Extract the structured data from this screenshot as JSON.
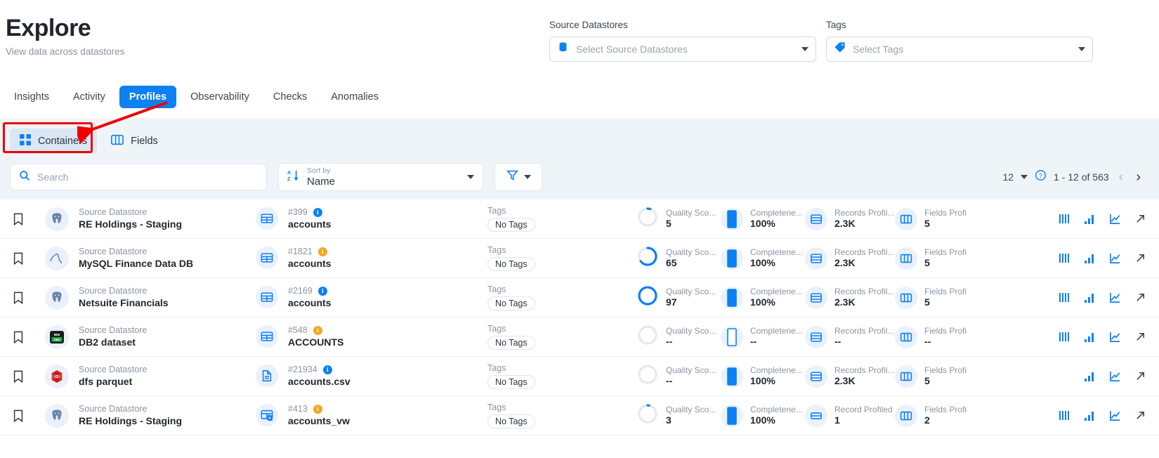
{
  "header": {
    "title": "Explore",
    "subtitle": "View data across datastores"
  },
  "filters": [
    {
      "label": "Source Datastores",
      "placeholder": "Select Source Datastores",
      "icon": "database-icon"
    },
    {
      "label": "Tags",
      "placeholder": "Select Tags",
      "icon": "tag-icon"
    }
  ],
  "tabs": [
    {
      "label": "Insights",
      "active": false
    },
    {
      "label": "Activity",
      "active": false
    },
    {
      "label": "Profiles",
      "active": true
    },
    {
      "label": "Observability",
      "active": false
    },
    {
      "label": "Checks",
      "active": false
    },
    {
      "label": "Anomalies",
      "active": false
    }
  ],
  "subnav": [
    {
      "label": "Containers",
      "icon": "grid-icon",
      "active": true,
      "highlighted": true
    },
    {
      "label": "Fields",
      "icon": "columns-icon",
      "active": false,
      "highlighted": false
    }
  ],
  "toolbar": {
    "search_placeholder": "Search",
    "search_icon": "search-icon",
    "sort_label": "Sort by",
    "sort_value": "Name",
    "sort_icon": "sort-az-icon",
    "filter_icon": "funnel-icon",
    "page_size": "12",
    "help_icon": "help-circle-icon",
    "range": "1 - 12 of 563",
    "prev_icon": "chevron-left-icon",
    "next_icon": "chevron-right-icon"
  },
  "colors": {
    "accent": "#0d80f2",
    "highlight": "#ef0000",
    "amber": "#f5a623",
    "panel": "#eff4f9"
  },
  "table": {
    "labels": {
      "datastore": "Source Datastore",
      "tags": "Tags",
      "quality": "Quality Sco...",
      "completeness": "Completene...",
      "records": "Records Profil...",
      "records_singular": "Record Profiled",
      "fields": "Fields Profi"
    },
    "rows": [
      {
        "bookmark_icon": "bookmark-icon",
        "datastore_icon": "postgresql-icon",
        "datastore_name": "RE Holdings - Staging",
        "container_icon": "table-icon",
        "container_id": "#399",
        "badge": "blue",
        "container_name": "accounts",
        "tags_label": "Tags",
        "tag": "No Tags",
        "quality_label": "Quality Sco...",
        "quality_value": "5",
        "quality_pct": 5,
        "completeness_label": "Completene...",
        "completeness_value": "100%",
        "completeness_pct": 100,
        "records_label": "Records Profil...",
        "records_value": "2.3K",
        "fields_label": "Fields Profi",
        "fields_value": "5",
        "actions": [
          "bars-icon",
          "bar-chart-icon",
          "line-chart-icon",
          "external-link-icon"
        ]
      },
      {
        "bookmark_icon": "bookmark-icon",
        "datastore_icon": "mysql-icon",
        "datastore_name": "MySQL Finance Data DB",
        "container_icon": "table-icon",
        "container_id": "#1821",
        "badge": "amber",
        "container_name": "accounts",
        "tags_label": "Tags",
        "tag": "No Tags",
        "quality_label": "Quality Sco...",
        "quality_value": "65",
        "quality_pct": 65,
        "completeness_label": "Completene...",
        "completeness_value": "100%",
        "completeness_pct": 100,
        "records_label": "Records Profil...",
        "records_value": "2.3K",
        "fields_label": "Fields Profi",
        "fields_value": "5",
        "actions": [
          "bars-icon",
          "bar-chart-icon",
          "line-chart-icon",
          "external-link-icon"
        ]
      },
      {
        "bookmark_icon": "bookmark-icon",
        "datastore_icon": "postgresql-icon",
        "datastore_name": "Netsuite Financials",
        "container_icon": "table-icon",
        "container_id": "#2169",
        "badge": "blue",
        "container_name": "accounts",
        "tags_label": "Tags",
        "tag": "No Tags",
        "quality_label": "Quality Sco...",
        "quality_value": "97",
        "quality_pct": 97,
        "completeness_label": "Completene...",
        "completeness_value": "100%",
        "completeness_pct": 100,
        "records_label": "Records Profil...",
        "records_value": "2.3K",
        "fields_label": "Fields Profi",
        "fields_value": "5",
        "actions": [
          "bars-icon",
          "bar-chart-icon",
          "line-chart-icon",
          "external-link-icon"
        ]
      },
      {
        "bookmark_icon": "bookmark-icon",
        "datastore_icon": "db2-icon",
        "datastore_name": "DB2 dataset",
        "container_icon": "table-icon",
        "container_id": "#548",
        "badge": "amber",
        "container_name": "ACCOUNTS",
        "tags_label": "Tags",
        "tag": "No Tags",
        "quality_label": "Quality Sco...",
        "quality_value": "--",
        "quality_pct": 0,
        "completeness_label": "Completene...",
        "completeness_value": "--",
        "completeness_pct": 0,
        "records_label": "Records Profil...",
        "records_value": "--",
        "fields_label": "Fields Profi",
        "fields_value": "--",
        "actions": [
          "bars-icon",
          "bar-chart-icon",
          "line-chart-icon",
          "external-link-icon"
        ]
      },
      {
        "bookmark_icon": "bookmark-icon",
        "datastore_icon": "parquet-icon",
        "datastore_name": "dfs parquet",
        "container_icon": "file-icon",
        "container_id": "#21934",
        "badge": "blue",
        "container_name": "accounts.csv",
        "tags_label": "Tags",
        "tag": "No Tags",
        "quality_label": "Quality Sco...",
        "quality_value": "--",
        "quality_pct": 0,
        "completeness_label": "Completene...",
        "completeness_value": "100%",
        "completeness_pct": 100,
        "records_label": "Records Profil...",
        "records_value": "2.3K",
        "fields_label": "Fields Profi",
        "fields_value": "5",
        "actions": [
          "",
          "bar-chart-icon",
          "line-chart-icon",
          "external-link-icon"
        ]
      },
      {
        "bookmark_icon": "bookmark-icon",
        "datastore_icon": "postgresql-icon",
        "datastore_name": "RE Holdings - Staging",
        "container_icon": "view-icon",
        "container_id": "#413",
        "badge": "amber",
        "container_name": "accounts_vw",
        "tags_label": "Tags",
        "tag": "No Tags",
        "quality_label": "Quality Sco...",
        "quality_value": "3",
        "quality_pct": 3,
        "completeness_label": "Completene...",
        "completeness_value": "100%",
        "completeness_pct": 100,
        "records_label": "Record Profiled",
        "records_value": "1",
        "fields_label": "Fields Profi",
        "fields_value": "2",
        "actions": [
          "bars-icon",
          "bar-chart-icon",
          "line-chart-icon",
          "external-link-icon"
        ]
      }
    ]
  }
}
